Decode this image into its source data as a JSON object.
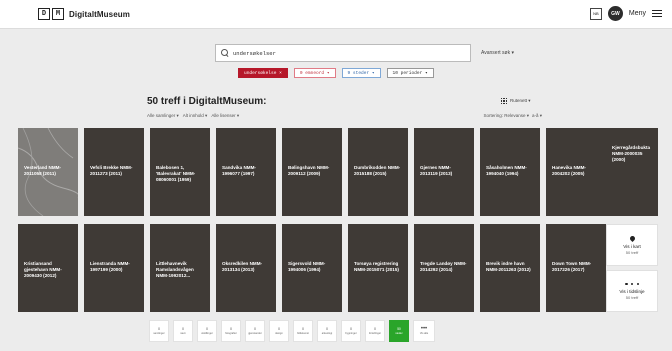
{
  "header": {
    "logo_d": "D",
    "logo_m": "M",
    "logo_text": "DigitaltMuseum",
    "lang": "NB",
    "avatar_initials": "GW",
    "menu_label": "Meny"
  },
  "search": {
    "value": "undersøkelser",
    "advanced_label": "Avansert søk ▾"
  },
  "chips": [
    {
      "label": "undersøkelse ×",
      "style": "red"
    },
    {
      "label": "0 emneord ▾",
      "style": "pink"
    },
    {
      "label": "9 steder ▾",
      "style": "blue"
    },
    {
      "label": "10 perioder ▾",
      "style": "gray"
    }
  ],
  "results": {
    "title": "50 treff i DigitaltMuseum:",
    "filters": [
      "Alle samlinger ▾",
      "Alt innhold ▾",
      "Alle lisenser ▾"
    ],
    "view_label": "Rutenett ▾",
    "sort_label": "Sortering: Relevanse ▾",
    "sort_order": "a-å ▾"
  },
  "row1": [
    "Vesterland NMM-2011058 (2011)",
    "Vefsli Brekke NMM-2011273 (2011)",
    "Balebosen 1, 'Balevrakat' NMM-08060001 (1959)",
    "Sandvika NMM-1996077 (1997)",
    "Bølingshavn NMM-2009112 (2009)",
    "Dumbrikodden NMM-2015188 (2015)",
    "Gjernes NMM-2013119 (2013)",
    "Såsaholmen NMM-1994040 (1994)",
    "Hanevika NMM-2004202 (2005)",
    "Kjerregårdsbukta NMM-2000035 (2000)"
  ],
  "row2": [
    "Kristiansand gjestehavn NMM-2009430 (2012)",
    "Lienstranda NMM-1997199 (2000)",
    "Littlehavnevik Ramslandsvågen NMM-1992012...",
    "Oksredkilen NMM-2013134 (2013)",
    "Sigersvold NMM-1994006 (1994)",
    "Torsøya registrering NMM-2015071 (2015)",
    "Tregde Landøy NMM-2014292 (2014)",
    "Brevik indre havn NMM-2011263 (2012)",
    "Down Town NMM-2017226 (2017)"
  ],
  "actions": {
    "map_label": "Vis i kart",
    "map_sub": "50 treff",
    "timeline_label": "Vis i tidslinje",
    "timeline_sub": "50 treff"
  },
  "bottom_bar": [
    {
      "n": "0",
      "label": "samlinger"
    },
    {
      "n": "0",
      "label": "navn"
    },
    {
      "n": "0",
      "label": "utstillinger"
    },
    {
      "n": "0",
      "label": "fotografier"
    },
    {
      "n": "0",
      "label": "gjenstander"
    },
    {
      "n": "0",
      "label": "design"
    },
    {
      "n": "0",
      "label": "bildekunst"
    },
    {
      "n": "0",
      "label": "arkeologi"
    },
    {
      "n": "0",
      "label": "bygninger"
    },
    {
      "n": "0",
      "label": "fortellinger"
    },
    {
      "n": "50",
      "label": "steder"
    },
    {
      "n": "•••",
      "label": "Vis alle"
    }
  ]
}
